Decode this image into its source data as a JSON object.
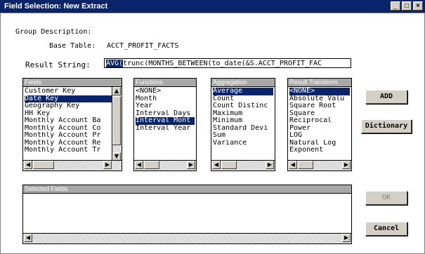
{
  "window": {
    "title": "Field Selection: New Extract",
    "minimize": "_",
    "maximize": "□",
    "close": "×"
  },
  "group_description_label": "Group Description:",
  "base_table": {
    "label": "Base Table:",
    "value": "ACCT_PROFIT_FACTS"
  },
  "result_string": {
    "label": "Result String:",
    "value_selected": "AVG(",
    "value_rest": "trunc(MONTHS_BETWEEN(to_date(&S.ACCT_PROFIT_FAC"
  },
  "fields": {
    "header": "Fields",
    "items": [
      "Customer Key",
      "Date Key",
      "Geography Key",
      "HH Key",
      "Monthly Account Ba",
      "Monthly Account Co",
      "Monthly Account Pr",
      "Monthly Account Re",
      "Monthly Account Tr"
    ],
    "selected": "Date Key"
  },
  "functions": {
    "header": "Functions",
    "items": [
      "<NONE>",
      "Month",
      "Year",
      "Interval Days",
      "Interval Mont",
      "Interval Year"
    ],
    "selected": "Interval Mont"
  },
  "aggregation": {
    "header": "Aggregation",
    "items": [
      "Average",
      "Count",
      "Count Distinc",
      "Maximum",
      "Minimum",
      "Standard Devi",
      "Sum",
      "Variance"
    ],
    "selected": "Average"
  },
  "result_transform": {
    "header": "Result Transform",
    "items": [
      "<NONE>",
      "Absolute Valu",
      "Square Root",
      "Square",
      "Reciprocal",
      "Power",
      "LOG",
      "Natural Log",
      "Exponent"
    ],
    "selected": "<NONE>"
  },
  "selected_fields": {
    "header": "Selected Fields"
  },
  "buttons": {
    "add": "ADD",
    "dictionary": "Dictionary",
    "ok": "OK",
    "cancel": "Cancel"
  },
  "scroll_glyphs": {
    "left": "◀",
    "right": "▶",
    "up": "▲",
    "down": "▼"
  }
}
